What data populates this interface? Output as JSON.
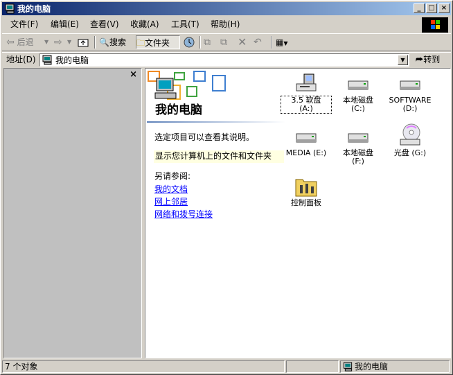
{
  "window": {
    "title": "我的电脑"
  },
  "menu": [
    {
      "id": "file",
      "label": "文件(F)"
    },
    {
      "id": "edit",
      "label": "编辑(E)"
    },
    {
      "id": "view",
      "label": "查看(V)"
    },
    {
      "id": "favorites",
      "label": "收藏(A)"
    },
    {
      "id": "tools",
      "label": "工具(T)"
    },
    {
      "id": "help",
      "label": "帮助(H)"
    }
  ],
  "toolbar": {
    "back": "后退",
    "search": "搜索",
    "folders": "文件夹"
  },
  "address": {
    "label": "地址(D)",
    "value": "我的电脑",
    "go": "转到"
  },
  "info_panel": {
    "title": "我的电脑",
    "description": "选定项目可以查看其说明。",
    "tip": "显示您计算机上的文件和文件夹",
    "see_also_label": "另请参阅:",
    "links": [
      "我的文档",
      "网上邻居",
      "网络和拨号连接"
    ]
  },
  "items": [
    {
      "label": "3.5 软盘\n(A:)",
      "icon": "floppy-drive-icon",
      "selected": true
    },
    {
      "label": "本地磁盘\n(C:)",
      "icon": "hard-disk-icon"
    },
    {
      "label": "SOFTWARE\n(D:)",
      "icon": "hard-disk-icon"
    },
    {
      "label": "MEDIA (E:)",
      "icon": "hard-disk-icon"
    },
    {
      "label": "本地磁盘\n(F:)",
      "icon": "hard-disk-icon"
    },
    {
      "label": "光盘 (G:)",
      "icon": "cd-drive-icon"
    },
    {
      "label": "控制面板",
      "icon": "control-panel-icon"
    }
  ],
  "statusbar": {
    "count": "7 个对象",
    "zone": "我的电脑"
  },
  "colors": {
    "titlebar_start": "#0a246a",
    "titlebar_end": "#a6caf0",
    "face": "#d4d0c8",
    "link": "#0000ff",
    "tip_bg": "#ffffe1"
  }
}
